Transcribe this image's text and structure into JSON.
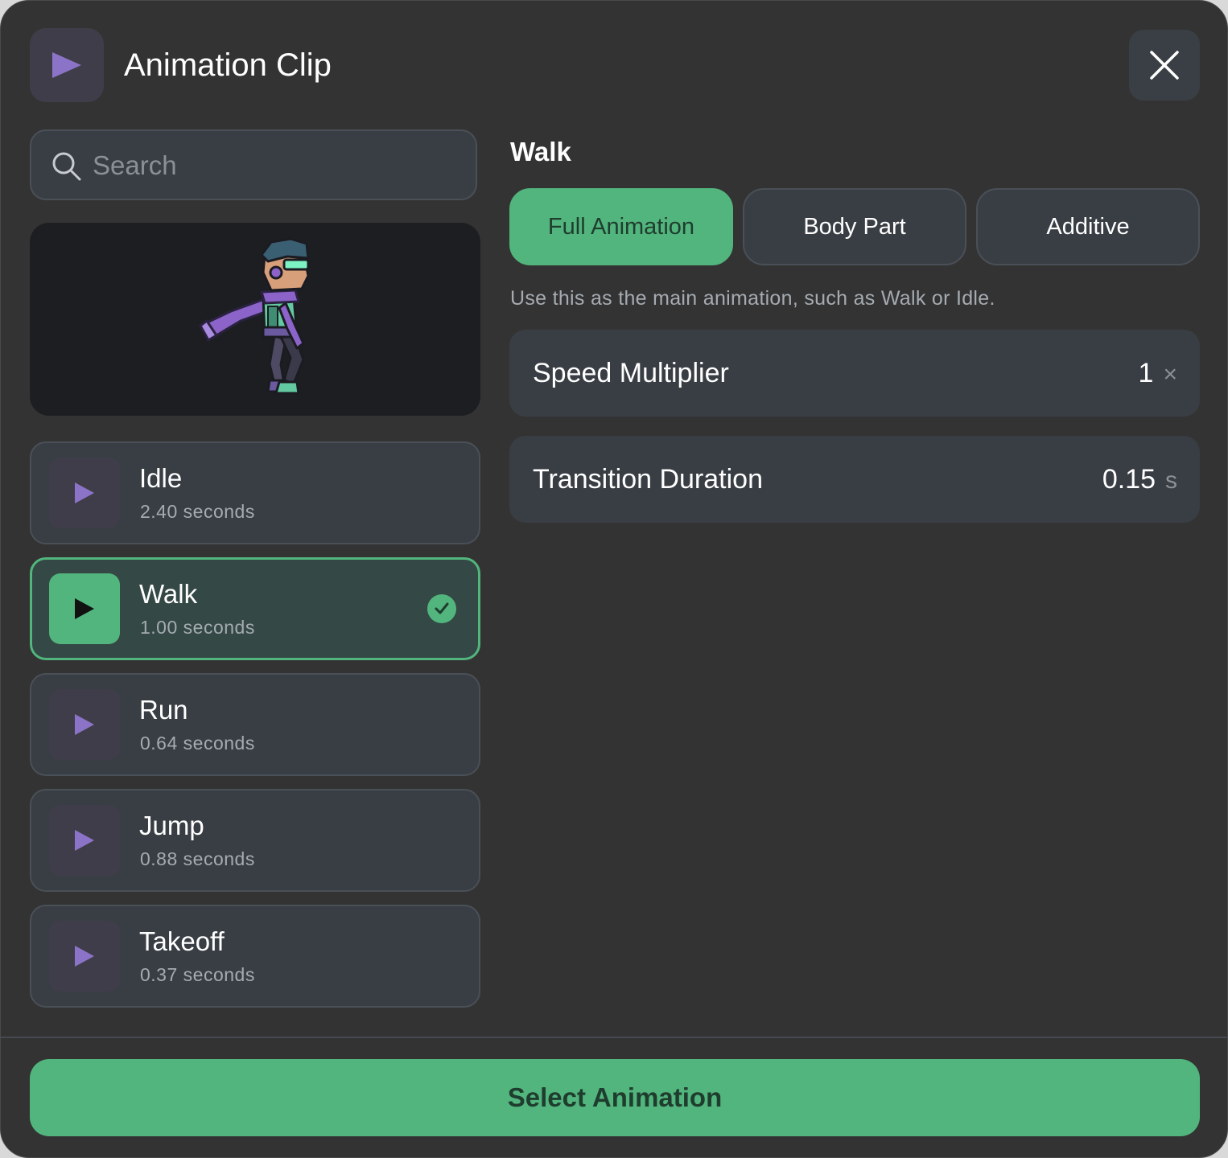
{
  "header": {
    "title": "Animation Clip",
    "icon": "play-icon",
    "close_icon": "close-icon"
  },
  "search": {
    "placeholder": "Search",
    "value": ""
  },
  "preview": {
    "icon": "character-preview"
  },
  "clips": [
    {
      "name": "Idle",
      "duration": "2.40 seconds",
      "selected": false
    },
    {
      "name": "Walk",
      "duration": "1.00 seconds",
      "selected": true
    },
    {
      "name": "Run",
      "duration": "0.64 seconds",
      "selected": false
    },
    {
      "name": "Jump",
      "duration": "0.88 seconds",
      "selected": false
    },
    {
      "name": "Takeoff",
      "duration": "0.37 seconds",
      "selected": false
    }
  ],
  "detail": {
    "title": "Walk",
    "modes": [
      "Full Animation",
      "Body Part",
      "Additive"
    ],
    "active_mode": "Full Animation",
    "hint": "Use this as the main animation, such as Walk or Idle.",
    "speed": {
      "label": "Speed Multiplier",
      "value": "1",
      "unit": "×"
    },
    "transition": {
      "label": "Transition Duration",
      "value": "0.15",
      "unit": "s"
    }
  },
  "footer": {
    "primary_label": "Select Animation"
  },
  "colors": {
    "background": "#333333",
    "accent": "#52b57d",
    "accent_text": "#1f3d2e",
    "card": "#393e44",
    "play_tile": "#403d4a",
    "play_glyph": "#8b74c7"
  }
}
